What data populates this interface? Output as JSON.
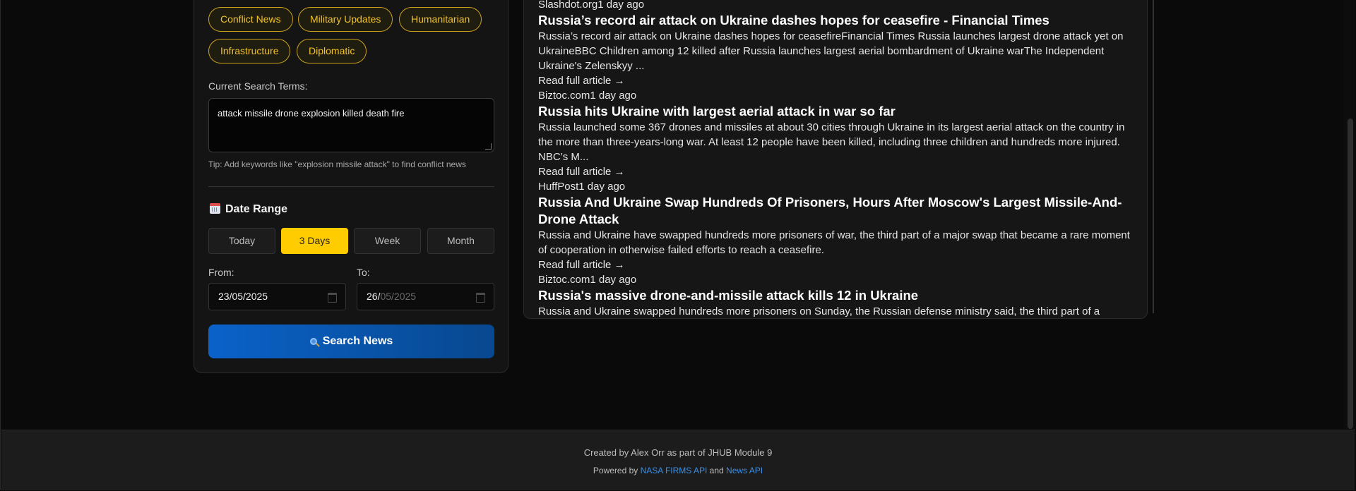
{
  "filters": {
    "chips": [
      "Conflict News",
      "Military Updates",
      "Humanitarian",
      "Infrastructure",
      "Diplomatic"
    ],
    "search_label": "Current Search Terms:",
    "search_terms": "attack missile drone explosion killed death fire",
    "tip": "Tip: Add keywords like \"explosion missile attack\" to find conflict news"
  },
  "date_range": {
    "heading": "Date Range",
    "buttons": [
      "Today",
      "3 Days",
      "Week",
      "Month"
    ],
    "active": "3 Days",
    "from_label": "From:",
    "to_label": "To:",
    "from_value": "23/05/2025",
    "to_day": "26/",
    "to_rest": "05/2025"
  },
  "search_button": "Search News",
  "articles": [
    {
      "meta_only": true,
      "meta": "Slashdot.org1 day ago"
    },
    {
      "title": "Russia’s record air attack on Ukraine dashes hopes for ceasefire - Financial Times",
      "desc": "Russia’s record air attack on Ukraine dashes hopes for ceasefireFinancial Times Russia launches largest drone attack yet on UkraineBBC Children among 12 killed after Russia launches largest aerial bombardment of Ukraine warThe Independent Ukraine's Zelenskyy ...",
      "link": "Read full article →",
      "meta": "Biztoc.com1 day ago"
    },
    {
      "title": "Russia hits Ukraine with largest aerial attack in war so far",
      "desc": "Russia launched some 367 drones and missiles at about 30 cities through Ukraine in its largest aerial attack on the country in the more than three-years-long war. At least 12 people have been killed, including three children and hundreds more injured. NBC’s M...",
      "link": "Read full article →",
      "meta": "HuffPost1 day ago"
    },
    {
      "title": "Russia And Ukraine Swap Hundreds Of Prisoners, Hours After Moscow's Largest Missile-And-Drone Attack",
      "desc": "Russia and Ukraine have swapped hundreds more prisoners of war, the third part of a major swap that became a rare moment of cooperation in otherwise failed efforts to reach a ceasefire.",
      "link": "Read full article →",
      "meta": "Biztoc.com1 day ago"
    },
    {
      "title": "Russia's massive drone-and-missile attack kills 12 in Ukraine",
      "desc": "Russia and Ukraine swapped hundreds more prisoners on Sunday, the Russian defense ministry said, the third part of a",
      "link": "",
      "meta": ""
    }
  ],
  "footer": {
    "credit": "Created by Alex Orr as part of JHUB Module 9",
    "powered_prefix": "Powered by ",
    "api1": "NASA FIRMS API",
    "and": " and ",
    "api2": "News API"
  },
  "colors": {
    "accent_yellow": "#ffcc00",
    "button_blue": "#0a62c9",
    "link_blue": "#3a8fe6"
  }
}
